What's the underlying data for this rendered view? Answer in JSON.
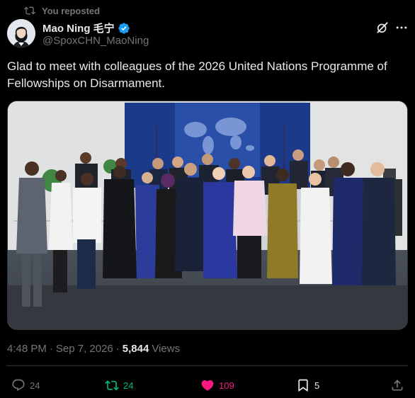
{
  "repost": {
    "label": "You reposted"
  },
  "author": {
    "name": "Mao Ning 毛宁",
    "handle": "@SpoxCHN_MaoNing"
  },
  "tweet": {
    "text": "Glad to meet with colleagues of the 2026 United Nations Programme of Fellowships on Disarmament."
  },
  "meta": {
    "time": "4:48 PM",
    "separator": "·",
    "date": "Sep 7, 2026",
    "separator2": "·",
    "views_count": "5,844",
    "views_label": "Views"
  },
  "actions": {
    "replies": "24",
    "reposts": "24",
    "likes": "109",
    "bookmarks": "5"
  },
  "colors": {
    "verified": "#1d9bf0",
    "repost_active": "#00ba7c",
    "like_active": "#f91880",
    "muted": "#71767b"
  },
  "icons": [
    "repost-icon",
    "verified-icon",
    "grok-icon",
    "more-icon",
    "reply-icon",
    "like-icon",
    "bookmark-icon",
    "share-icon"
  ]
}
